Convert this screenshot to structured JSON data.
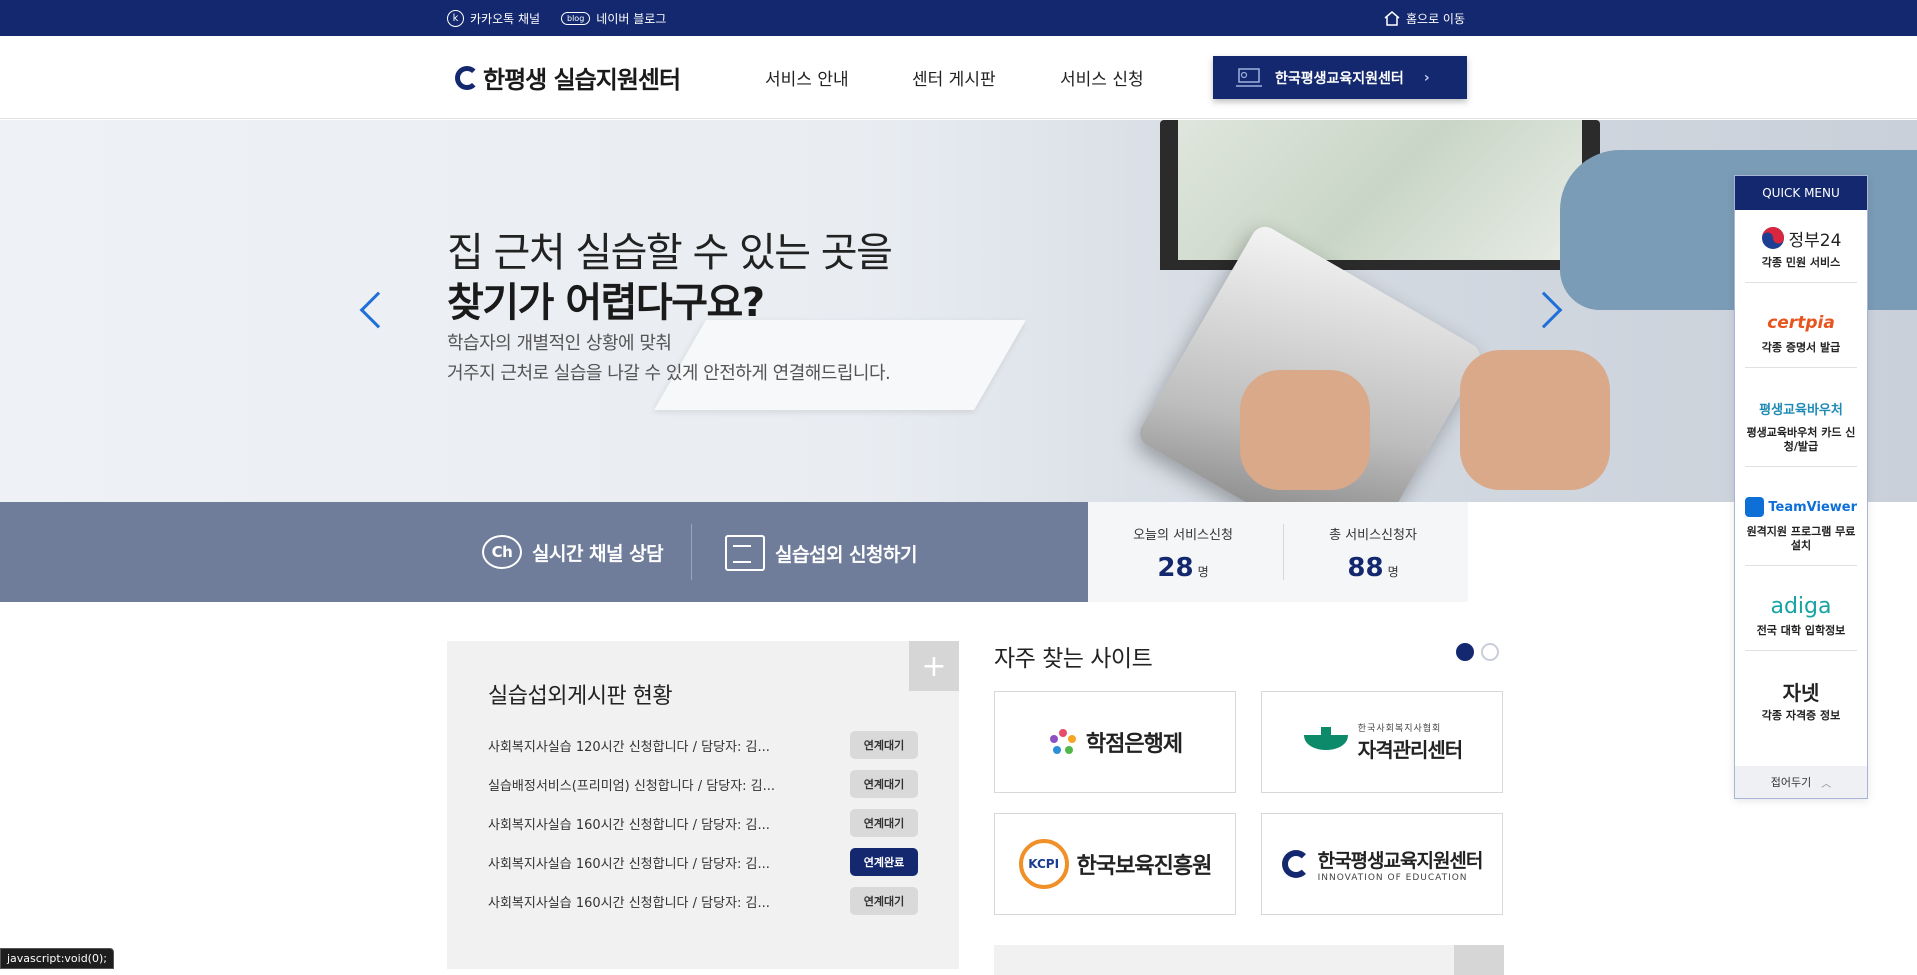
{
  "topbar": {
    "kakao_icon": "k",
    "kakao_label": "카카오톡 채널",
    "blog_icon": "blog",
    "blog_label": "네이버 블로그",
    "home_label": "홈으로 이동"
  },
  "header": {
    "logo_text": "한평생 실습지원센터",
    "nav": [
      "서비스 안내",
      "센터 게시판",
      "서비스 신청"
    ],
    "kied_button": "한국평생교육지원센터"
  },
  "hero": {
    "title_line1": "집 근처 실습할 수 있는 곳을",
    "title_line2": "찾기가 어렵다구요?",
    "sub_line1": "학습자의 개별적인 상황에 맞춰",
    "sub_line2": "거주지 근처로 실습을 나갈 수 있게 안전하게 연결해드립니다."
  },
  "actions": {
    "chat_icon_text": "Ch",
    "chat_label": "실시간 채널 상담",
    "apply_label": "실습섭외 신청하기"
  },
  "stats": {
    "today_label": "오늘의 서비스신청",
    "today_value": "28",
    "total_label": "총 서비스신청자",
    "total_value": "88",
    "unit": "명"
  },
  "board": {
    "title": "실습섭외게시판 현황",
    "plus": "+",
    "rows": [
      {
        "text": "사회복지사실습 120시간 신청합니다 / 담당자: 김...",
        "status": "연계대기"
      },
      {
        "text": "실습배정서비스(프리미엄) 신청합니다 / 담당자: 김...",
        "status": "연계대기"
      },
      {
        "text": "사회복지사실습 160시간 신청합니다 / 담당자: 김...",
        "status": "연계대기"
      },
      {
        "text": "사회복지사실습 160시간 신청합니다 / 담당자: 김...",
        "status": "연계완료"
      },
      {
        "text": "사회복지사실습 160시간 신청합니다 / 담당자: 김...",
        "status": "연계대기"
      }
    ]
  },
  "favorites": {
    "title": "자주 찾는 사이트",
    "sites": [
      {
        "name": "학점은행제",
        "sub": ""
      },
      {
        "name": "자격관리센터",
        "sub": "한국사회복지사협회"
      },
      {
        "name": "한국보육진흥원",
        "sub": "KCPI"
      },
      {
        "name": "한국평생교육지원센터",
        "sub": "INNOVATION OF EDUCATION"
      }
    ]
  },
  "quick_menu": {
    "title": "QUICK MENU",
    "items": [
      {
        "logo": "정부24",
        "label": "각종 민원 서비스",
        "color": "#1a1a1a"
      },
      {
        "logo": "certpia",
        "label": "각종 증명서 발급",
        "color": "#e8541e"
      },
      {
        "logo": "평생교육바우처",
        "label": "평생교육바우처 카드 신청/발급",
        "color": "#1f8ab5"
      },
      {
        "logo": "TeamViewer",
        "label": "원격지원 프로그램 무료설치",
        "color": "#0e6fd6"
      },
      {
        "logo": "adiga",
        "label": "전국 대학 입학정보",
        "color": "#17a3a3"
      },
      {
        "logo": "자넷",
        "label": "각종 자격증 정보",
        "color": "#1a1a1a"
      }
    ],
    "collapse_label": "접어두기"
  },
  "status_bar": "javascript:void(0);"
}
